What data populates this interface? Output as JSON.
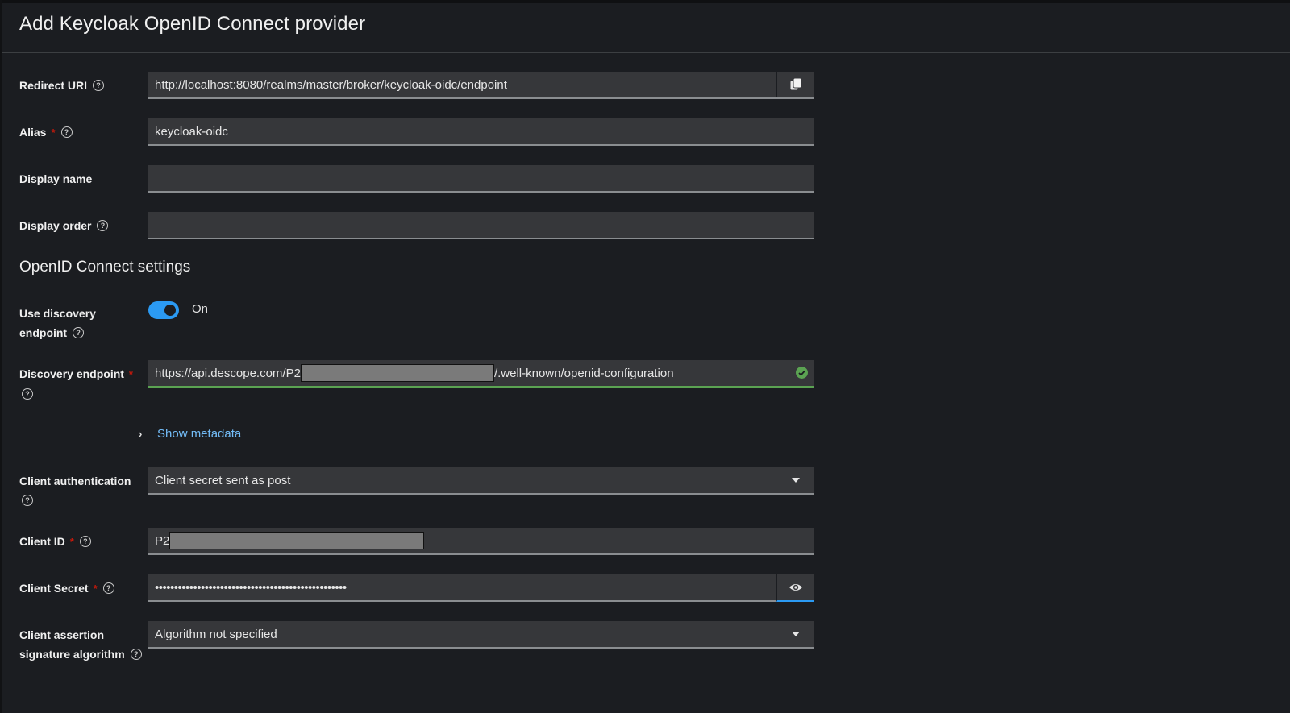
{
  "page": {
    "title": "Add Keycloak OpenID Connect provider"
  },
  "general": {
    "redirect_uri": {
      "label": "Redirect URI",
      "value": "http://localhost:8080/realms/master/broker/keycloak-oidc/endpoint",
      "copy_icon": "copy-icon"
    },
    "alias": {
      "label": "Alias",
      "required": "*",
      "value": "keycloak-oidc"
    },
    "display_name": {
      "label": "Display name",
      "value": ""
    },
    "display_order": {
      "label": "Display order",
      "value": ""
    }
  },
  "oidc": {
    "section_title": "OpenID Connect settings",
    "use_discovery": {
      "label_line1": "Use discovery",
      "label_line2": "endpoint",
      "state": "On",
      "enabled": true
    },
    "discovery_endpoint": {
      "label": "Discovery endpoint",
      "required": "*",
      "value_prefix": "https://api.descope.com/P2",
      "value_suffix": "/.well-known/openid-configuration",
      "status": "valid"
    },
    "show_metadata": "Show metadata",
    "client_authentication": {
      "label": "Client authentication",
      "value": "Client secret sent as post"
    },
    "client_id": {
      "label": "Client ID",
      "required": "*",
      "value_prefix": "P2"
    },
    "client_secret": {
      "label": "Client Secret",
      "required": "*",
      "value": "••••••••••••••••••••••••••••••••••••••••••••••••••"
    },
    "client_assertion": {
      "label_line1": "Client assertion",
      "label_line2": "signature algorithm",
      "value": "Algorithm not specified"
    }
  },
  "help_icon_glyph": "?"
}
